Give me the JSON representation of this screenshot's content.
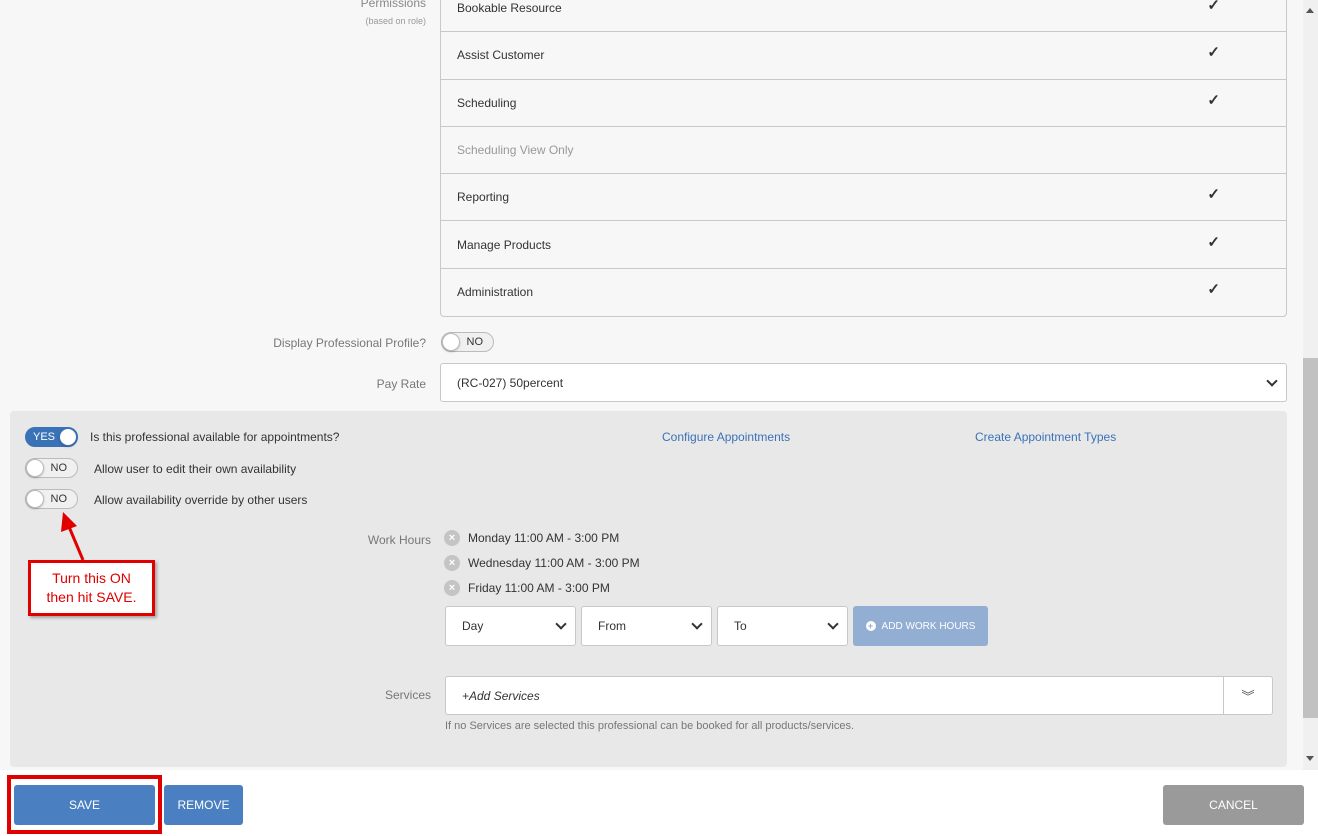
{
  "permissions": {
    "label": "Permissions",
    "sublabel": "(based on role)",
    "items": [
      {
        "name": "Bookable Resource",
        "check": "✓"
      },
      {
        "name": "Assist Customer",
        "check": "✓"
      },
      {
        "name": "Scheduling",
        "check": "✓"
      },
      {
        "name": "Scheduling View Only",
        "check": ""
      },
      {
        "name": "Reporting",
        "check": "✓"
      },
      {
        "name": "Manage Products",
        "check": "✓"
      },
      {
        "name": "Administration",
        "check": "✓"
      }
    ]
  },
  "display_profile": {
    "label": "Display Professional Profile?",
    "value": "NO"
  },
  "pay_rate": {
    "label": "Pay Rate",
    "value": "(RC-027) 50percent"
  },
  "availability": {
    "available": {
      "value": "YES",
      "text": "Is this professional available for appointments?"
    },
    "edit_own": {
      "value": "NO",
      "text": "Allow user to edit their own availability"
    },
    "override": {
      "value": "NO",
      "text": "Allow availability override by other users"
    },
    "configure_link": "Configure Appointments",
    "create_types_link": "Create Appointment Types"
  },
  "work_hours": {
    "label": "Work Hours",
    "entries": [
      "Monday 11:00 AM - 3:00 PM",
      "Wednesday 11:00 AM - 3:00 PM",
      "Friday 11:00 AM - 3:00 PM"
    ],
    "day_select": "Day",
    "from_select": "From",
    "to_select": "To",
    "add_button": "ADD WORK HOURS"
  },
  "services": {
    "label": "Services",
    "placeholder": "+Add Services",
    "help": "If no Services are selected this professional can be booked for all products/services."
  },
  "callout": {
    "line1": "Turn this ON",
    "line2": "then hit SAVE."
  },
  "footer": {
    "save": "SAVE",
    "remove": "REMOVE",
    "cancel": "CANCEL"
  },
  "colors": {
    "accent": "#3a72b8",
    "button": "#4a7fc1",
    "annotation": "#e00000",
    "cancel": "#9a9a9a"
  }
}
